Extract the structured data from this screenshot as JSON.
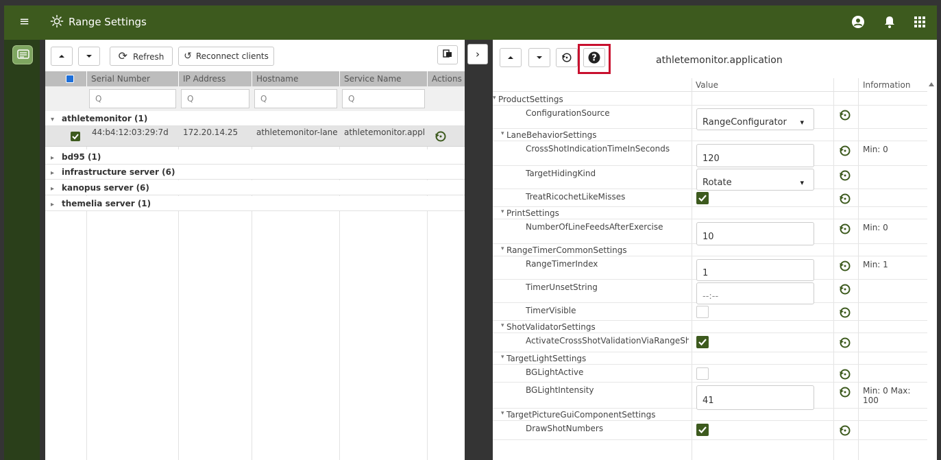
{
  "app": {
    "title": "Range Settings"
  },
  "toolbar_left": {
    "refresh_label": "Refresh",
    "reconnect_label": "Reconnect clients"
  },
  "grid": {
    "headers": [
      "Serial Number",
      "IP Address",
      "Hostname",
      "Service Name",
      "Actions"
    ],
    "filter_placeholder": "Q",
    "groups": [
      {
        "label": "athletemonitor (1)",
        "expanded": true
      },
      {
        "label": "bd95 (1)",
        "expanded": false
      },
      {
        "label": "infrastructure server (6)",
        "expanded": false
      },
      {
        "label": "kanopus server (6)",
        "expanded": false
      },
      {
        "label": "themelia server (1)",
        "expanded": false
      }
    ],
    "row": {
      "serial": "44:b4:12:03:29:7d",
      "ip": "172.20.14.25",
      "hostname": "athletemonitor-lane...",
      "service": "athletemonitor.appli..."
    }
  },
  "right": {
    "title": "athletemonitor.application",
    "col_value": "Value",
    "col_info": "Information",
    "rows": [
      {
        "label": "ProductSettings"
      },
      {
        "label": "ConfigurationSource",
        "value": "RangeConfigurator"
      },
      {
        "label": "LaneBehaviorSettings"
      },
      {
        "label": "CrossShotIndicationTimeInSeconds",
        "value": "120",
        "info": "Min: 0"
      },
      {
        "label": "TargetHidingKind",
        "value": "Rotate"
      },
      {
        "label": "TreatRicochetLikeMisses",
        "checked": true
      },
      {
        "label": "PrintSettings"
      },
      {
        "label": "NumberOfLineFeedsAfterExercise",
        "value": "10",
        "info": "Min: 0"
      },
      {
        "label": "RangeTimerCommonSettings"
      },
      {
        "label": "RangeTimerIndex",
        "value": "1",
        "info": "Min: 1"
      },
      {
        "label": "TimerUnsetString",
        "value": "--:--"
      },
      {
        "label": "TimerVisible",
        "checked": false
      },
      {
        "label": "ShotValidatorSettings"
      },
      {
        "label": "ActivateCrossShotValidationViaRangeShotVa",
        "checked": true
      },
      {
        "label": "TargetLightSettings"
      },
      {
        "label": "BGLightActive",
        "checked": false
      },
      {
        "label": "BGLightIntensity",
        "value": "41",
        "info": "Min: 0 Max: 100"
      },
      {
        "label": "TargetPictureGuiComponentSettings"
      },
      {
        "label": "DrawShotNumbers",
        "checked": true
      }
    ]
  },
  "colors": {
    "header_green": "#3d5a1e",
    "rail": "#2a3f1a",
    "highlight": "#c8102e"
  }
}
